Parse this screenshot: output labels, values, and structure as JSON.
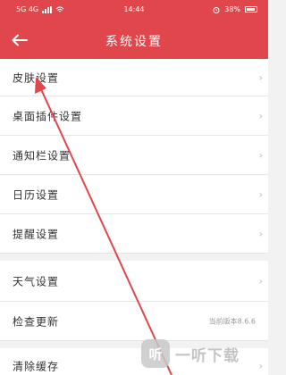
{
  "status_bar": {
    "left_text": "5G 4G",
    "time": "14:44",
    "right_text": "38%"
  },
  "header": {
    "title": "系统设置",
    "back_icon": "back-arrow-icon"
  },
  "settings": {
    "items": [
      {
        "label": "皮肤设置",
        "value": ""
      },
      {
        "label": "桌面插件设置",
        "value": ""
      },
      {
        "label": "通知栏设置",
        "value": ""
      },
      {
        "label": "日历设置",
        "value": ""
      },
      {
        "label": "提醒设置",
        "value": ""
      },
      {
        "label": "天气设置",
        "value": ""
      },
      {
        "label": "检查更新",
        "value": "当前版本8.6.6"
      },
      {
        "label": "清除缓存",
        "value": ""
      }
    ]
  },
  "watermark": {
    "text": "一听下载"
  },
  "colors": {
    "accent": "#e0474c",
    "annotation_arrow": "#e0474c"
  }
}
